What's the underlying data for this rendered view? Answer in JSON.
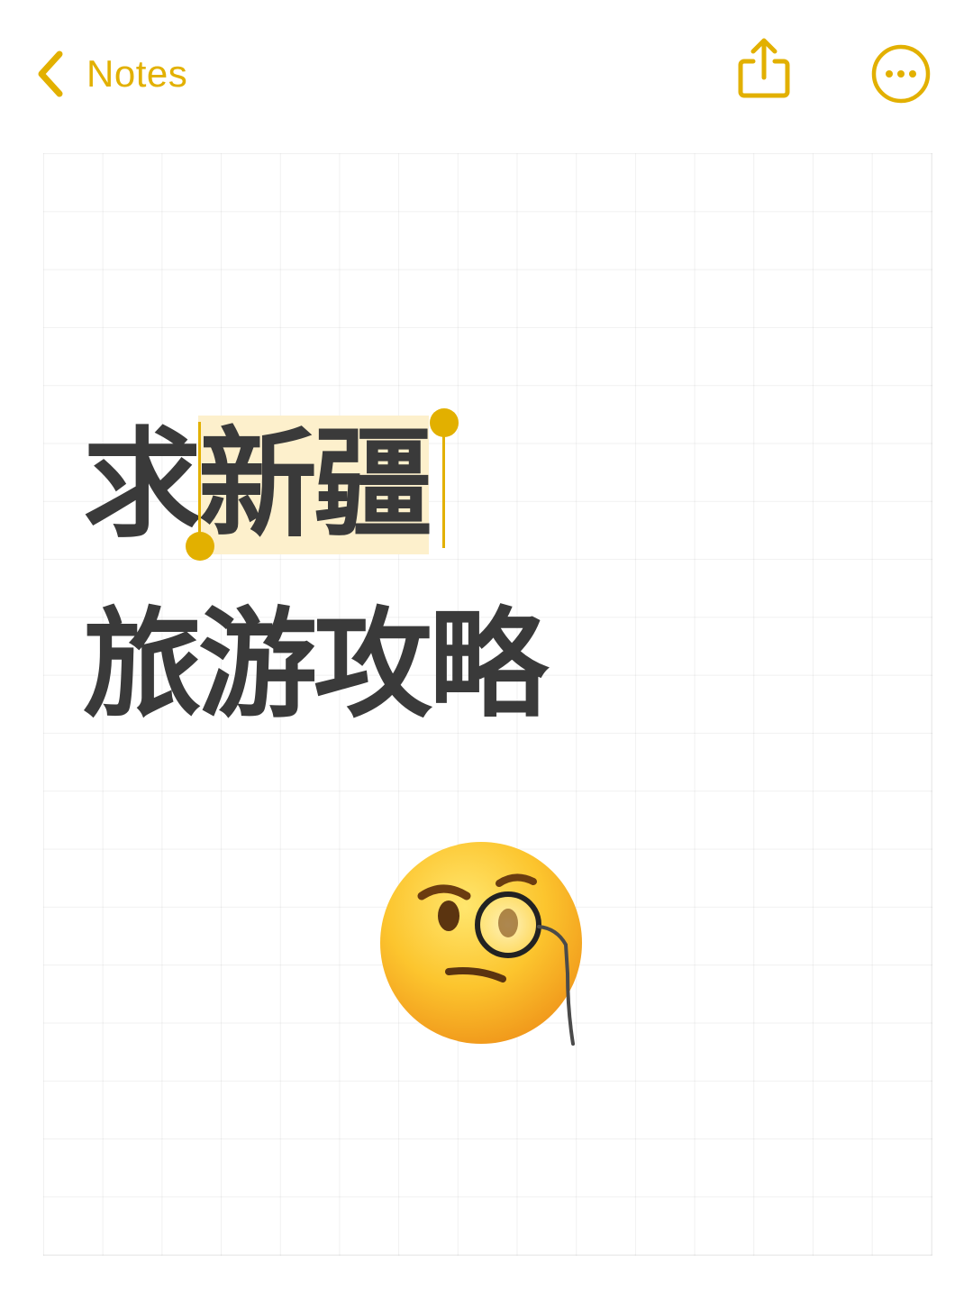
{
  "nav": {
    "back_label": "Notes",
    "back_icon": "chevron-left-icon",
    "share_icon": "share-icon",
    "more_icon": "ellipsis-circle-icon"
  },
  "note": {
    "line1_prefix": "求",
    "line1_selected": "新疆",
    "line2": "旅游攻略",
    "emoji": "face-with-monocle"
  },
  "colors": {
    "accent": "#e2b000",
    "selection_highlight": "#fdf0cc",
    "text": "#3a3a3a",
    "grid": "#efefef",
    "background": "#ffffff"
  }
}
